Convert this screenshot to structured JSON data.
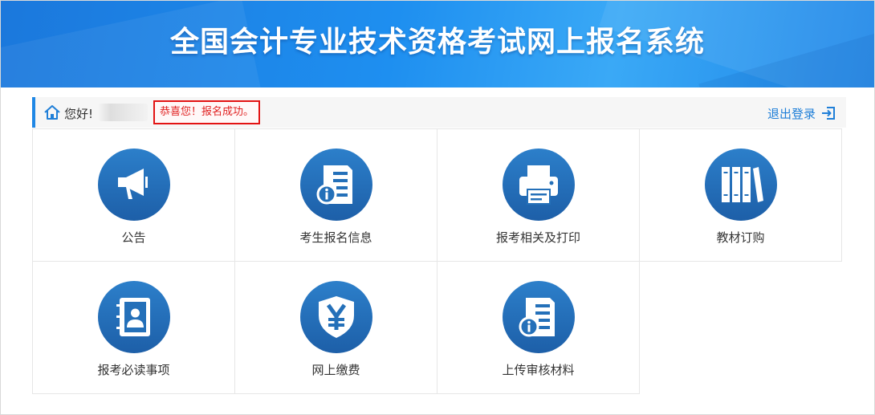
{
  "header": {
    "title": "全国会计专业技术资格考试网上报名系统"
  },
  "userbar": {
    "greeting": "您好!",
    "success_message": "恭喜您！报名成功。",
    "logout_label": "退出登录"
  },
  "colors": {
    "brand_blue": "#1e8ff0",
    "icon_blue": "#2470b9",
    "alert_red": "#e31313"
  },
  "menu": {
    "items": [
      {
        "label": "公告",
        "icon": "megaphone-icon"
      },
      {
        "label": "考生报名信息",
        "icon": "info-document-icon"
      },
      {
        "label": "报考相关及打印",
        "icon": "printer-icon"
      },
      {
        "label": "教材订购",
        "icon": "books-icon"
      },
      {
        "label": "报考必读事项",
        "icon": "contact-book-icon"
      },
      {
        "label": "网上缴费",
        "icon": "yen-shield-icon"
      },
      {
        "label": "上传审核材料",
        "icon": "info-document-icon"
      }
    ]
  }
}
